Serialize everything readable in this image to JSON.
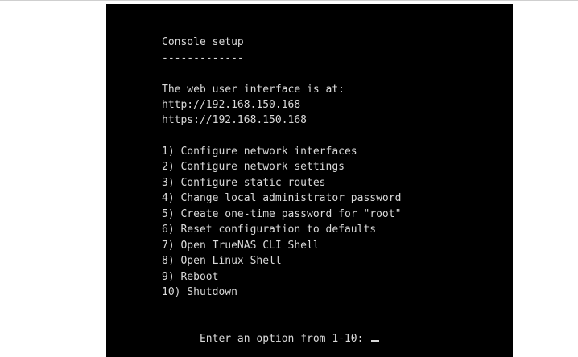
{
  "console": {
    "title": "Console setup",
    "title_underline": "-------------",
    "web_ui_intro": "The web user interface is at:",
    "http_url": "http://192.168.150.168",
    "https_url": "https://192.168.150.168",
    "menu": [
      {
        "label": "1) Configure network interfaces"
      },
      {
        "label": "2) Configure network settings"
      },
      {
        "label": "3) Configure static routes"
      },
      {
        "label": "4) Change local administrator password"
      },
      {
        "label": "5) Create one-time password for \"root\""
      },
      {
        "label": "6) Reset configuration to defaults"
      },
      {
        "label": "7) Open TrueNAS CLI Shell"
      },
      {
        "label": "8) Open Linux Shell"
      },
      {
        "label": "9) Reboot"
      },
      {
        "label": "10) Shutdown"
      }
    ],
    "prompt": "Enter an option from 1-10: ",
    "input_value": ""
  }
}
